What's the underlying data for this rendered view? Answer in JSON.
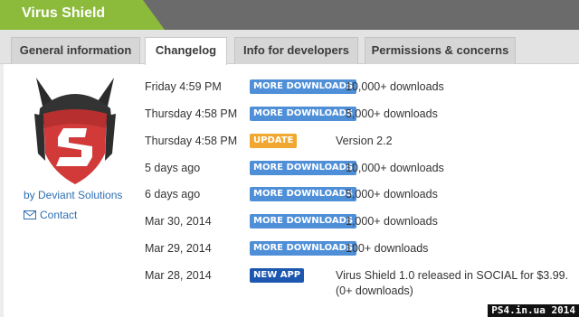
{
  "header": {
    "title": "Virus Shield",
    "colors": {
      "brand": "#8cbb3c",
      "bar": "#6b6b6b"
    }
  },
  "tabs": [
    {
      "label": "General information",
      "active": false
    },
    {
      "label": "Changelog",
      "active": true
    },
    {
      "label": "Info for developers",
      "active": false
    },
    {
      "label": "Permissions & concerns",
      "active": false
    }
  ],
  "sidebar": {
    "logo_icon": "shield-s-logo",
    "developer": "by Deviant Solutions",
    "contact_label": "Contact",
    "contact_icon": "envelope-icon"
  },
  "changelog": [
    {
      "date": "Friday 4:59 PM",
      "badge": "MORE DOWNLOADS",
      "type": "more",
      "text": "10,000+ downloads"
    },
    {
      "date": "Thursday 4:58 PM",
      "badge": "MORE DOWNLOADS",
      "type": "more",
      "text": "5,000+ downloads"
    },
    {
      "date": "Thursday 4:58 PM",
      "badge": "UPDATE",
      "type": "update",
      "text": "Version 2.2"
    },
    {
      "date": "5 days ago",
      "badge": "MORE DOWNLOADS",
      "type": "more",
      "text": "10,000+ downloads"
    },
    {
      "date": "6 days ago",
      "badge": "MORE DOWNLOADS",
      "type": "more",
      "text": "5,000+ downloads"
    },
    {
      "date": "Mar 30, 2014",
      "badge": "MORE DOWNLOADS",
      "type": "more",
      "text": "1,000+ downloads"
    },
    {
      "date": "Mar 29, 2014",
      "badge": "MORE DOWNLOADS",
      "type": "more",
      "text": "100+ downloads"
    },
    {
      "date": "Mar 28, 2014",
      "badge": "NEW APP",
      "type": "newapp",
      "text": "Virus Shield 1.0 released in SOCIAL for $3.99. (0+ downloads)"
    }
  ],
  "badge_colors": {
    "more": "#4f8fd8",
    "update": "#f0a830",
    "newapp": "#1d57b0"
  },
  "watermark": "PS4.in.ua  2014"
}
